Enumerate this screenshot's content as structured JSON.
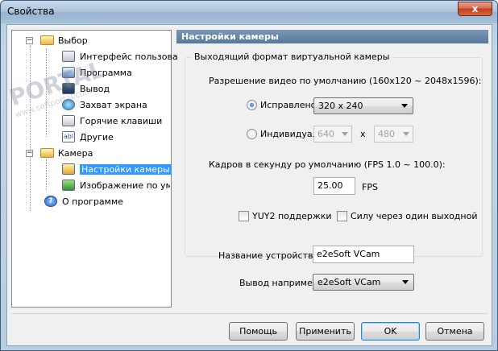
{
  "window": {
    "title": "Свойства",
    "close": "x"
  },
  "tree": {
    "items": [
      {
        "label": "Выбор",
        "level": 0,
        "expander": "−"
      },
      {
        "label": "Интерфейс пользова",
        "level": 1
      },
      {
        "label": "Программа",
        "level": 1
      },
      {
        "label": "Вывод",
        "level": 1
      },
      {
        "label": "Захват экрана",
        "level": 1
      },
      {
        "label": "Горячие клавиши",
        "level": 1
      },
      {
        "label": "Другие",
        "level": 1
      },
      {
        "label": "Камера",
        "level": 0,
        "expander": "−"
      },
      {
        "label": "Настройки камеры",
        "level": 1,
        "selected": true
      },
      {
        "label": "Изображение по умол",
        "level": 1
      },
      {
        "label": "О программе",
        "level": 0
      }
    ]
  },
  "panel": {
    "header": "Настройки камеры",
    "group_title": "Выходящий формат виртуальной камеры",
    "resolution_label": "Разрешение видео по умолчанию (160x120 ~ 2048x1596):",
    "fixed_label": "Исправлено:",
    "fixed_value": "320 x 240",
    "custom_label": "Индивидуальны",
    "custom_width": "640",
    "custom_sep": "x",
    "custom_height": "480",
    "fps_label": "Кадров в секунду ро умолчанию (FPS 1.0 ~ 100.0):",
    "fps_value": "25.00",
    "fps_unit": "FPS",
    "yuy2_label": "YUY2 поддержки",
    "force_label": "Силу через один выходной р",
    "device_name_label": "Название устройства:",
    "device_name_value": "e2eSoft VCam",
    "output_label": "Вывод например:",
    "output_value": "e2eSoft VCam"
  },
  "buttons": {
    "help": "Помощь",
    "apply": "Применить",
    "ok": "OK",
    "cancel": "Отмена"
  },
  "watermark": {
    "text": "PORTAL",
    "url": "www.softportal.com"
  },
  "colors": {
    "selection": "#3399ff",
    "header": "#56799e"
  }
}
